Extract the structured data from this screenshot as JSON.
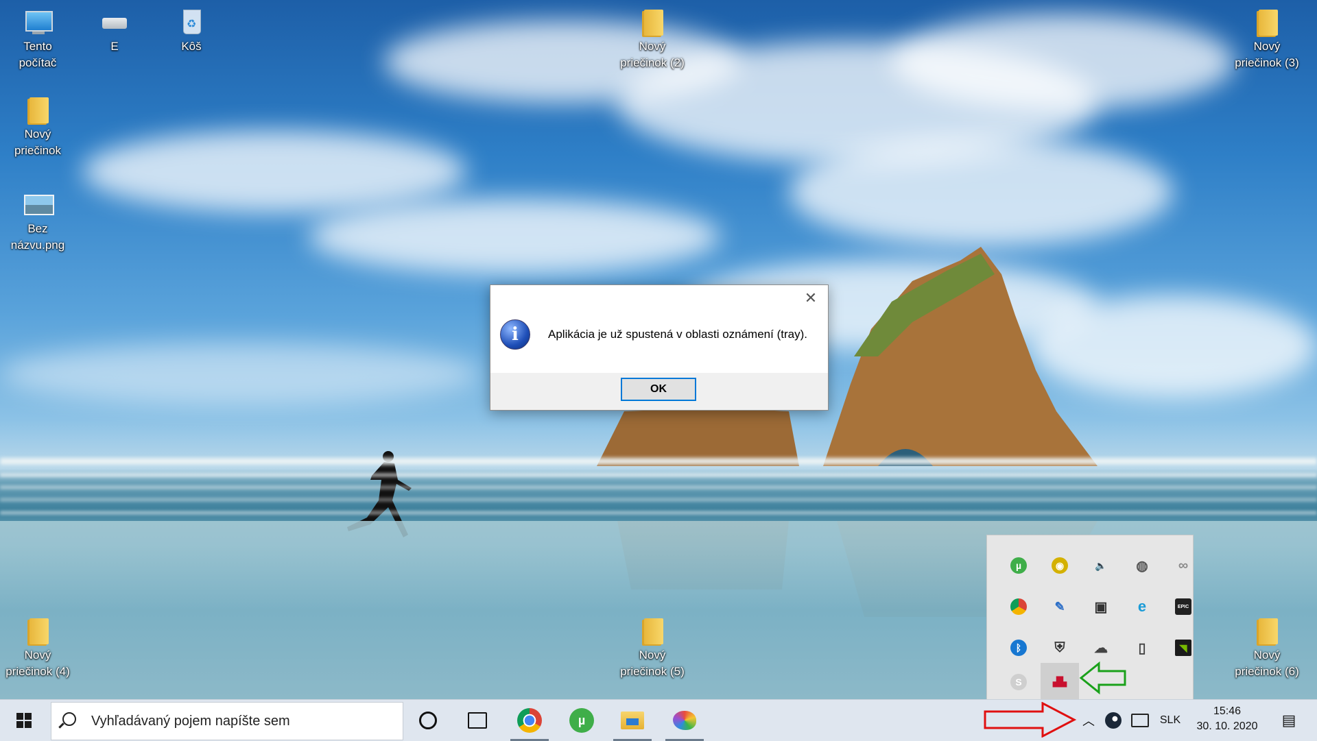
{
  "desktop": {
    "icons": [
      {
        "label": "Tento počítač"
      },
      {
        "label": "E"
      },
      {
        "label": "Kôš"
      },
      {
        "label": "Nový priečinok (2)"
      },
      {
        "label": "Nový priečinok (3)"
      },
      {
        "label": "Nový priečinok"
      },
      {
        "label": "Bez názvu.png"
      },
      {
        "label": "Nový priečinok (4)"
      },
      {
        "label": "Nový priečinok (5)"
      },
      {
        "label": "Nový priečinok (6)"
      }
    ]
  },
  "dialog": {
    "message": "Aplikácia je už spustená v oblasti oznámení (tray).",
    "ok_label": "OK",
    "close_glyph": "✕",
    "info_glyph": "i"
  },
  "tray_overflow": {
    "icons": [
      {
        "name": "utorrent-icon",
        "glyph": "µ",
        "color": "#3fae49"
      },
      {
        "name": "cd-drive-icon",
        "glyph": "◉",
        "color": "#d4b100"
      },
      {
        "name": "volume-icon",
        "glyph": "🔈",
        "color": "#333333"
      },
      {
        "name": "steering-wheel-icon",
        "glyph": "◍",
        "color": "#555555"
      },
      {
        "name": "link-icon",
        "glyph": "∞",
        "color": "#8a8a8a"
      },
      {
        "name": "chrome-icon",
        "glyph": "●",
        "color": "#db4437"
      },
      {
        "name": "pen-tablet-icon",
        "glyph": "✎",
        "color": "#2d6fc7"
      },
      {
        "name": "camera-app-icon",
        "glyph": "▣",
        "color": "#333333"
      },
      {
        "name": "edge-icon",
        "glyph": "e",
        "color": "#1a9bd7"
      },
      {
        "name": "epic-games-icon",
        "glyph": "EPIC",
        "color": "#222222"
      },
      {
        "name": "bluetooth-icon",
        "glyph": "ᛒ",
        "color": "#1777d1"
      },
      {
        "name": "security-shield-icon",
        "glyph": "⛨",
        "color": "#333333"
      },
      {
        "name": "onedrive-icon",
        "glyph": "☁",
        "color": "#444444"
      },
      {
        "name": "usb-drive-icon",
        "glyph": "▯",
        "color": "#444444"
      },
      {
        "name": "nvidia-icon",
        "glyph": "◥",
        "color": "#76b900"
      },
      {
        "name": "skype-icon",
        "glyph": "S",
        "color": "#cfcfcf"
      },
      {
        "name": "app-tray-icon",
        "glyph": "▟▙",
        "color": "#c8102e"
      }
    ]
  },
  "taskbar": {
    "search_placeholder": "Vyhľadávaný pojem napíšte sem",
    "pinned": [
      {
        "name": "chrome-taskbar-icon",
        "glyph": "●",
        "color": "#db4437"
      },
      {
        "name": "utorrent-taskbar-icon",
        "glyph": "µ",
        "color": "#3fae49"
      },
      {
        "name": "file-explorer-icon",
        "glyph": "",
        "color": "#e5b133"
      },
      {
        "name": "paint-icon",
        "glyph": "",
        "color": "#e94c3d"
      }
    ],
    "chevron_glyph": "︿",
    "language": "SLK",
    "time": "15:46",
    "date": "30. 10. 2020",
    "notification_glyph": "▤"
  },
  "colors": {
    "accent": "#0078d7",
    "arrow_red": "#e01010",
    "arrow_green": "#1aa11a"
  }
}
